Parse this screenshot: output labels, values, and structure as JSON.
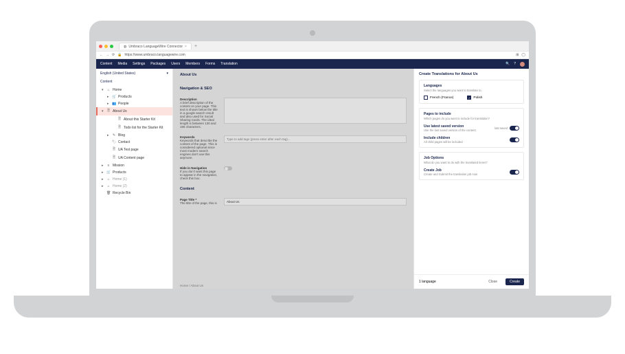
{
  "browser": {
    "tab_title": "Umbraco LanguageWire Connector",
    "url": "https://www.umbraco.languagewire.com"
  },
  "topnav": {
    "items": [
      "Content",
      "Media",
      "Settings",
      "Packages",
      "Users",
      "Members",
      "Forms",
      "Translation"
    ]
  },
  "sidebar": {
    "language": "English (United States)",
    "content_label": "Content",
    "tree": [
      {
        "caret": "▾",
        "icon": "⌂",
        "label": "Home"
      },
      {
        "caret": "▸",
        "icon": "🛒",
        "label": "Products",
        "indent": 1
      },
      {
        "caret": "▸",
        "icon": "👥",
        "label": "People",
        "indent": 1
      },
      {
        "caret": "▾",
        "icon": "🗎",
        "label": "About Us",
        "indent": 1,
        "selected": true
      },
      {
        "caret": "",
        "icon": "🗎",
        "label": "About this Starter Kit",
        "indent": 2
      },
      {
        "caret": "",
        "icon": "🗎",
        "label": "Todo list for the Starter Kit",
        "indent": 2
      },
      {
        "caret": "▸",
        "icon": "✎",
        "label": "Blog",
        "indent": 1
      },
      {
        "caret": "",
        "icon": "🏷",
        "label": "Contact",
        "indent": 1
      },
      {
        "caret": "",
        "icon": "🗎",
        "label": "UA Test page",
        "indent": 1
      },
      {
        "caret": "",
        "icon": "🗎",
        "label": "UA Content page",
        "indent": 1
      },
      {
        "caret": "▸",
        "icon": "≡",
        "label": "Mission"
      },
      {
        "caret": "▸",
        "icon": "🛒",
        "label": "Products"
      },
      {
        "caret": "▸",
        "icon": "⌂",
        "label": "Home (1)",
        "muted": true
      },
      {
        "caret": "▸",
        "icon": "⌂",
        "label": "Home (2)",
        "muted": true
      },
      {
        "caret": "",
        "icon": "🗑",
        "label": "Recycle Bin"
      }
    ]
  },
  "editor": {
    "page_title": "About Us",
    "sections": {
      "nav_seo": "Navigation & SEO",
      "desc_title": "Description",
      "desc_help": "A brief description of the content on your page. This text is shown below the title in a google search result and also used for Social Sharing Cards. The ideal length is between 130 and 155 characters.",
      "keywords_title": "Keywords",
      "keywords_help": "Keywords that describe the content of the page. This is considered optional since most modern search engines don't use this anymore.",
      "keywords_placeholder": "Type to add tags (press enter after each tag)...",
      "hide_title": "Hide in Navigation",
      "hide_help": "If you don't want this page to appear in the navigation, check this box.",
      "content_section": "Content",
      "pagetitle_label": "Page Title",
      "pagetitle_help": "The title of the page, this is",
      "pagetitle_value": "About Us"
    },
    "breadcrumb": "Home / About Us"
  },
  "panel": {
    "title": "Create Translations for About Us",
    "languages": {
      "title": "Languages",
      "subtitle": "Select the languages you want to translate to.",
      "options": [
        {
          "label": "French (France)",
          "checked": false
        },
        {
          "label": "Polish",
          "checked": true
        }
      ]
    },
    "pages": {
      "title": "Pages to include",
      "subtitle": "Which pages do you want to include for translation?",
      "opts": [
        {
          "title": "Use latest saved version",
          "sub": "Use the last saved version of the content.",
          "tag": "last saved",
          "on": true
        },
        {
          "title": "Include children",
          "sub": "All child pages will be included",
          "on": true
        }
      ]
    },
    "job": {
      "title": "Job Options",
      "subtitle": "What do you want to do with the translated items?",
      "opts": [
        {
          "title": "Create Job",
          "sub": "Create and Submit the translation job now",
          "on": true
        }
      ]
    },
    "footer": {
      "count": "1 language",
      "close": "Close",
      "create": "Create"
    }
  }
}
